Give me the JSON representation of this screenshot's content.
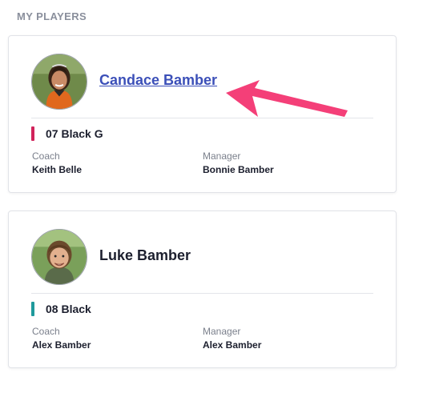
{
  "section": {
    "title": "MY PLAYERS"
  },
  "players": [
    {
      "name": "Candace Bamber",
      "team": "07 Black G",
      "team_color": "#d1235b",
      "coach_label": "Coach",
      "coach": "Keith Belle",
      "manager_label": "Manager",
      "manager": "Bonnie Bamber",
      "avatar_icon": "player-photo"
    },
    {
      "name": "Luke Bamber",
      "team": "08 Black",
      "team_color": "#1f9a9c",
      "coach_label": "Coach",
      "coach": "Alex Bamber",
      "manager_label": "Manager",
      "manager": "Alex Bamber",
      "avatar_icon": "player-photo"
    }
  ],
  "annotation": {
    "arrow_color": "#f43f78",
    "icon": "pointer-arrow"
  },
  "colors": {
    "link": "#3b4fb8",
    "text": "#1c1f2e",
    "muted": "#7b808c"
  }
}
